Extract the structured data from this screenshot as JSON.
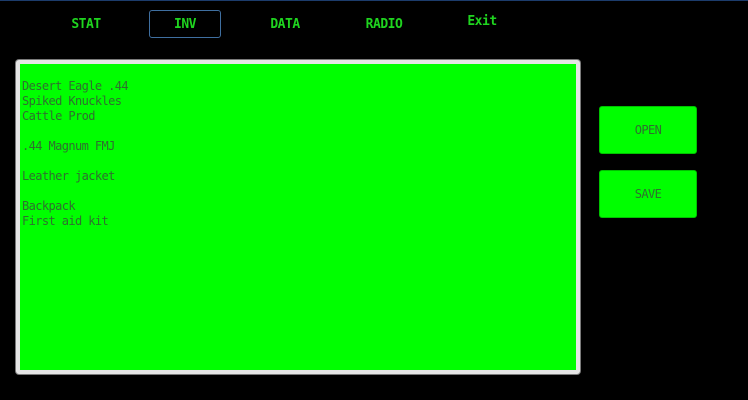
{
  "nav": {
    "tabs": [
      {
        "label": "STAT"
      },
      {
        "label": "INV"
      },
      {
        "label": "DATA"
      },
      {
        "label": "RADIO"
      },
      {
        "label": "Exit"
      }
    ],
    "active_tab": "INV"
  },
  "editor": {
    "content": "Desert Eagle .44\nSpiked Knuckles\nCattle Prod\n\n.44 Magnum FMJ\n\nLeather jacket\n\nBackpack\nFirst aid kit"
  },
  "actions": {
    "open_label": "OPEN",
    "save_label": "SAVE"
  },
  "colors": {
    "background": "#000000",
    "accent_green": "#00ff00",
    "tab_text": "#1fd41f",
    "active_tab_border": "#3f6fa0"
  }
}
